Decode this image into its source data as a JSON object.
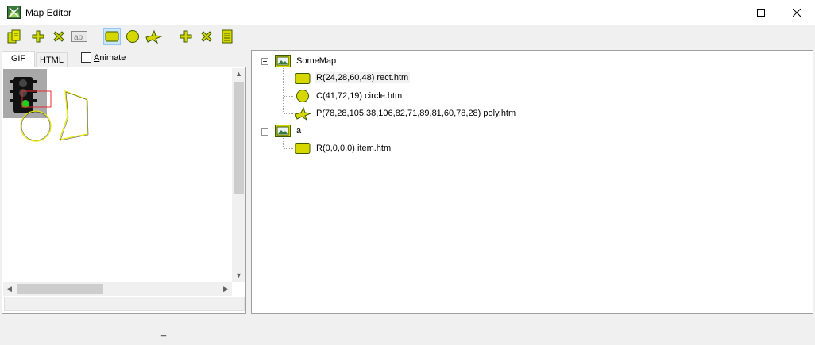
{
  "window": {
    "title": "Map Editor",
    "controls": [
      "minimize",
      "maximize",
      "close"
    ]
  },
  "toolbar": {
    "buttons": [
      {
        "icon": "copy-docs-icon"
      },
      {
        "icon": "add-icon"
      },
      {
        "icon": "delete-icon"
      },
      {
        "icon": "rename-icon",
        "label": "ab"
      },
      {
        "icon": "rectangle-tool-icon",
        "pressed": true
      },
      {
        "icon": "circle-tool-icon"
      },
      {
        "icon": "polygon-tool-icon"
      },
      {
        "icon": "add-area-icon"
      },
      {
        "icon": "delete-area-icon"
      },
      {
        "icon": "properties-icon"
      }
    ]
  },
  "left_pane": {
    "tabs": [
      {
        "label": "GIF",
        "active": true
      },
      {
        "label": "HTML",
        "active": false
      }
    ],
    "animate": {
      "label_underlined": "A",
      "label_rest": "nimate",
      "checked": false
    }
  },
  "tree": {
    "nodes": [
      {
        "label": "SomeMap",
        "icon": "map-image-icon",
        "level": 0,
        "expanded": true,
        "children": [
          {
            "label": "R(24,28,60,48) rect.htm",
            "icon": "rect-area-icon",
            "selected": true
          },
          {
            "label": "C(41,72,19) circle.htm",
            "icon": "circle-area-icon"
          },
          {
            "label": "P(78,28,105,38,106,82,71,89,81,60,78,28) poly.htm",
            "icon": "poly-area-icon"
          }
        ]
      },
      {
        "label": "a",
        "icon": "map-image-icon",
        "level": 0,
        "expanded": true,
        "children": [
          {
            "label": "R(0,0,0,0) item.htm",
            "icon": "rect-area-icon"
          }
        ]
      }
    ]
  },
  "status_bar": {
    "text": "_"
  },
  "colors": {
    "area_fill": "#d7d700",
    "area_outline": "#3d5c00",
    "selection_rect": "#e03030",
    "shape_outline": "#e6e600"
  }
}
